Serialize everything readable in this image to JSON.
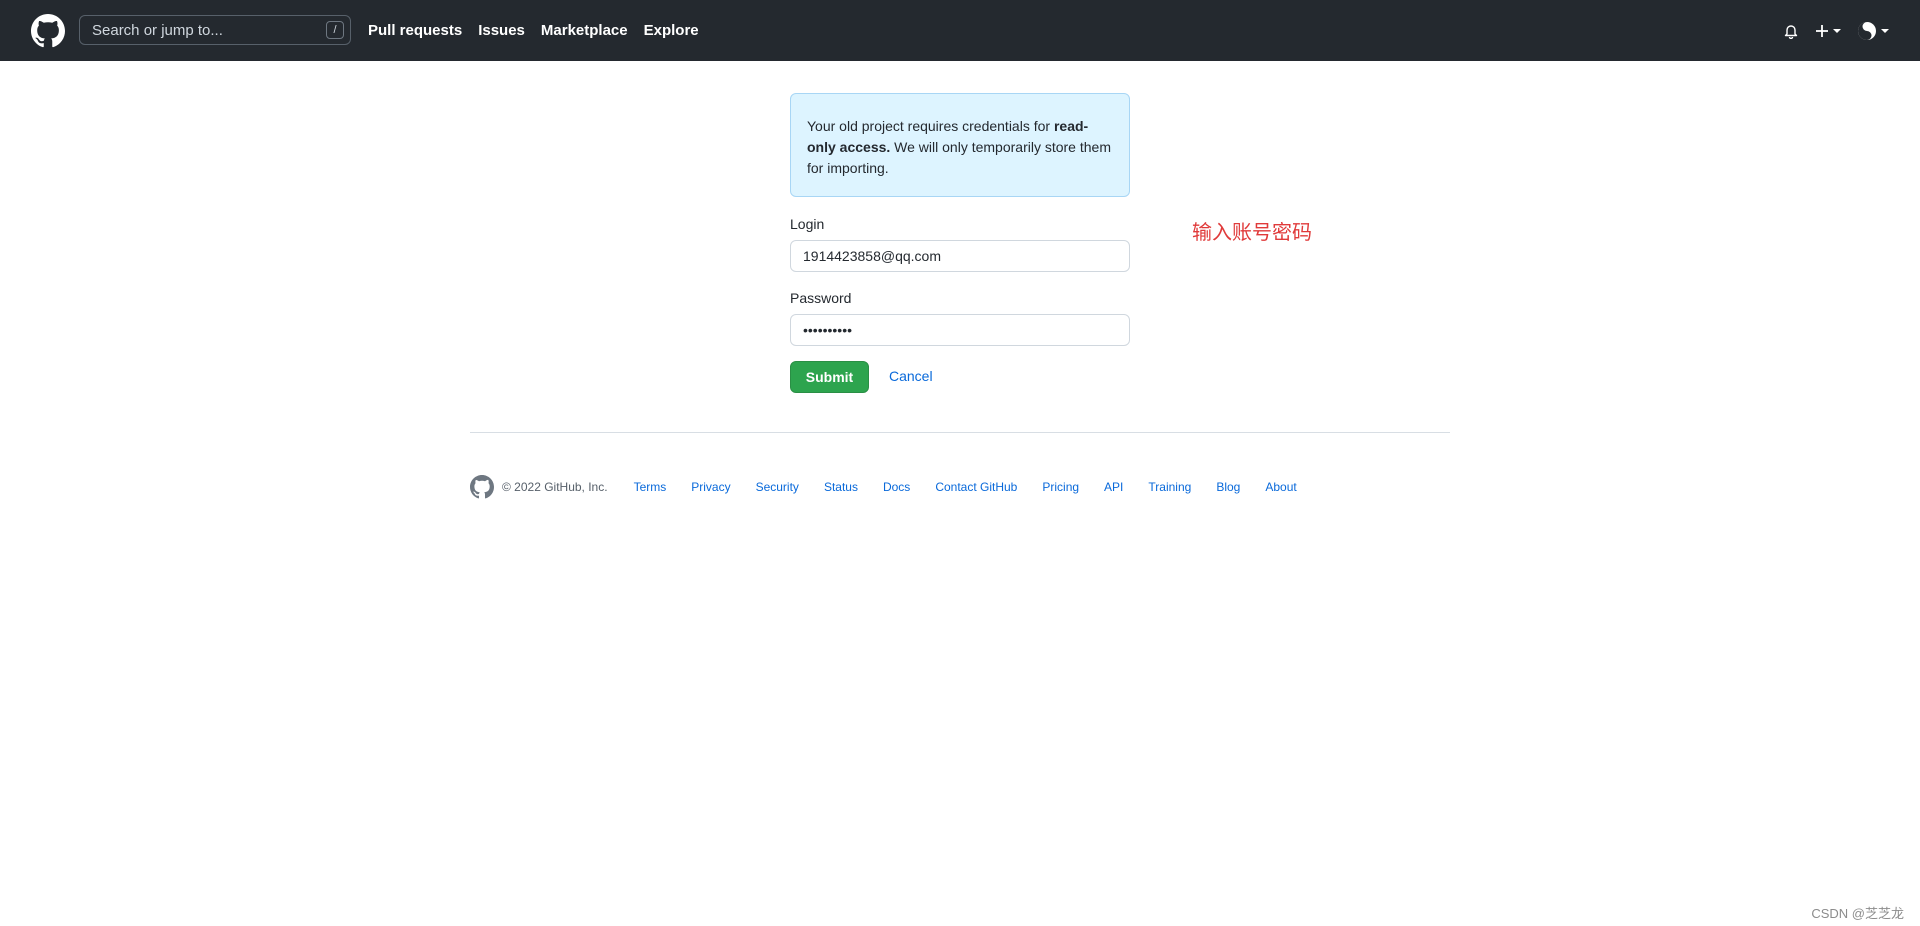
{
  "header": {
    "search_placeholder": "Search or jump to...",
    "search_key": "/",
    "nav": [
      "Pull requests",
      "Issues",
      "Marketplace",
      "Explore"
    ],
    "icons": [
      "bell-icon",
      "plus-icon",
      "avatar"
    ]
  },
  "flash": {
    "text_before": "Your old project requires credentials for ",
    "text_bold": "read-only access.",
    "text_after": " We will only temporarily store them for importing."
  },
  "form": {
    "login_label": "Login",
    "login_value": "1914423858@qq.com",
    "password_label": "Password",
    "password_value": "••••••••••",
    "submit_label": "Submit",
    "cancel_label": "Cancel"
  },
  "annotation": "输入账号密码",
  "footer": {
    "copyright": "© 2022 GitHub, Inc.",
    "links": [
      "Terms",
      "Privacy",
      "Security",
      "Status",
      "Docs",
      "Contact GitHub",
      "Pricing",
      "API",
      "Training",
      "Blog",
      "About"
    ]
  },
  "watermark": "CSDN @芝芝龙",
  "colors": {
    "header_bg": "#24292f",
    "flash_bg": "#ddf4ff",
    "submit_bg": "#2da44e",
    "link": "#0969da",
    "annotation": "#e03a3a"
  }
}
